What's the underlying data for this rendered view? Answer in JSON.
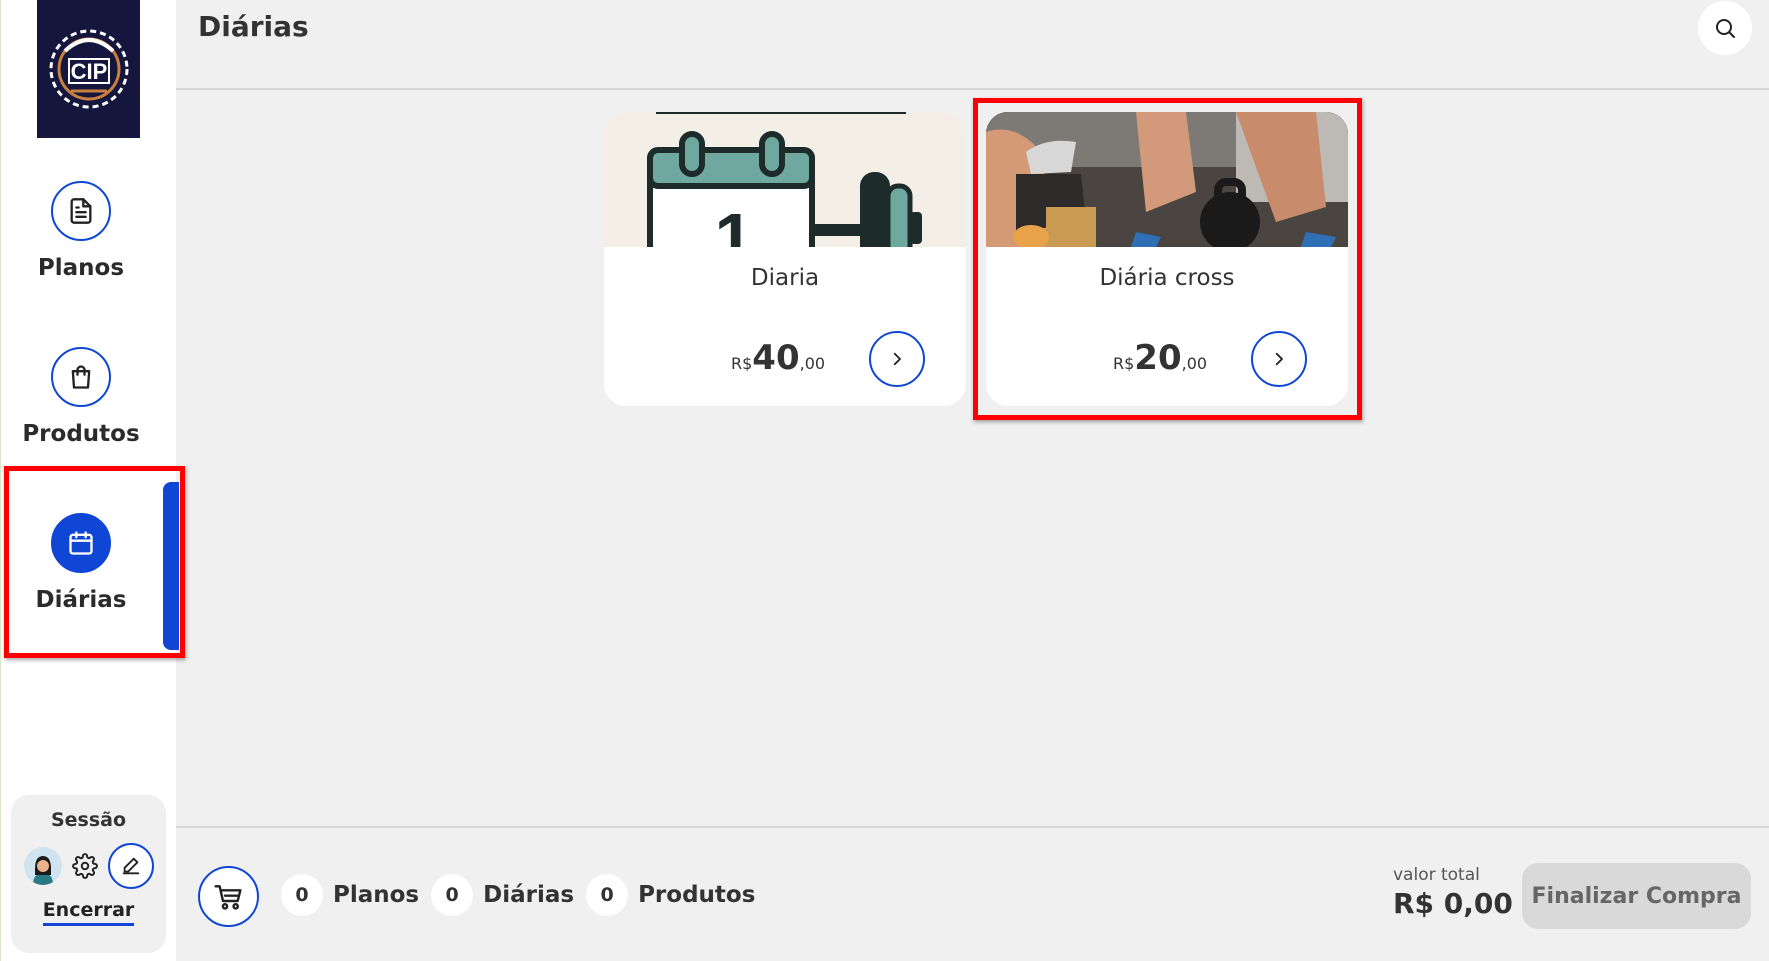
{
  "header": {
    "title": "Diárias"
  },
  "sidebar": {
    "items": [
      {
        "label": "Planos",
        "icon": "document-icon",
        "active": false
      },
      {
        "label": "Produtos",
        "icon": "shopping-bag-icon",
        "active": false
      },
      {
        "label": "Diárias",
        "icon": "calendar-icon",
        "active": true
      }
    ],
    "session": {
      "title": "Sessão",
      "end_label": "Encerrar"
    }
  },
  "cards": [
    {
      "title": "Diaria",
      "currency": "R$",
      "price_int": "40",
      "price_dec": ",00"
    },
    {
      "title": "Diária cross",
      "currency": "R$",
      "price_int": "20",
      "price_dec": ",00"
    }
  ],
  "cart": {
    "counts": [
      {
        "value": "0",
        "label": "Planos"
      },
      {
        "value": "0",
        "label": "Diárias"
      },
      {
        "value": "0",
        "label": "Produtos"
      }
    ],
    "total_label": "valor total",
    "total_value": "R$ 0,00",
    "finish_label": "Finalizar Compra"
  },
  "colors": {
    "accent": "#1046d6",
    "highlight": "#ff0000",
    "background": "#f0f0f0"
  }
}
